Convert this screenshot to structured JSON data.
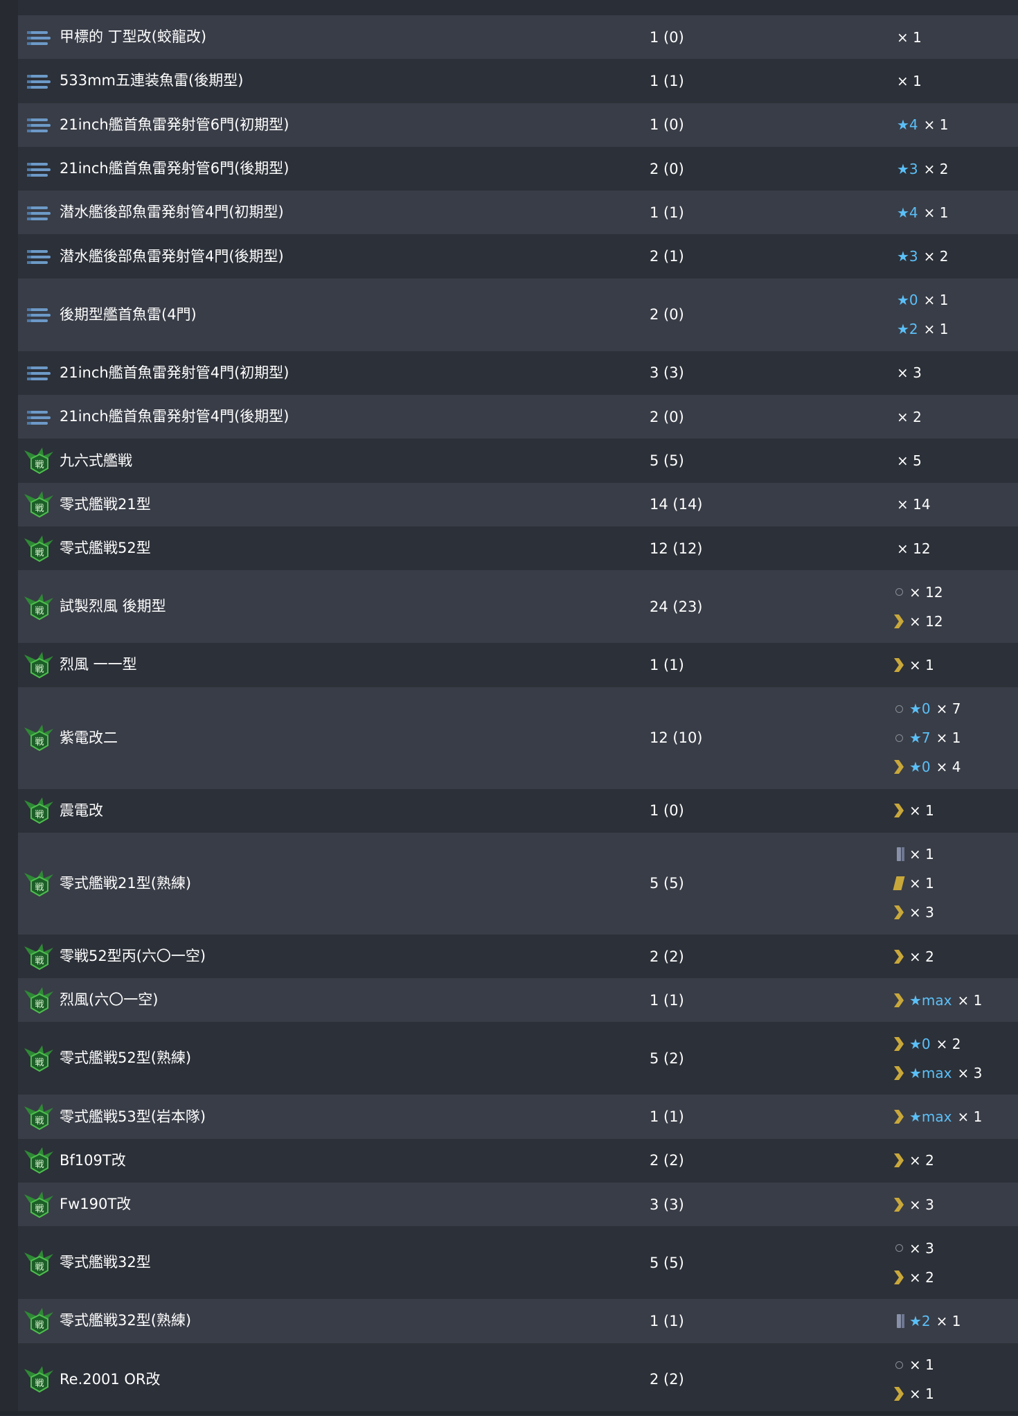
{
  "rows": [
    {
      "name": "甲標的 丁型改(蛟龍改)",
      "count": "1 (0)",
      "icon": "torpedo-icon",
      "stock": [
        {
          "slot": "none",
          "star": "",
          "qty": "× 1"
        }
      ]
    },
    {
      "name": "533mm五連装魚雷(後期型)",
      "count": "1 (1)",
      "icon": "torpedo-icon",
      "stock": [
        {
          "slot": "none",
          "star": "",
          "qty": "× 1"
        }
      ]
    },
    {
      "name": "21inch艦首魚雷発射管6門(初期型)",
      "count": "1 (0)",
      "icon": "torpedo-icon",
      "stock": [
        {
          "slot": "none",
          "star": "★4",
          "qty": "× 1"
        }
      ]
    },
    {
      "name": "21inch艦首魚雷発射管6門(後期型)",
      "count": "2 (0)",
      "icon": "torpedo-icon",
      "stock": [
        {
          "slot": "none",
          "star": "★3",
          "qty": "× 2"
        }
      ]
    },
    {
      "name": "潜水艦後部魚雷発射管4門(初期型)",
      "count": "1 (1)",
      "icon": "torpedo-icon",
      "stock": [
        {
          "slot": "none",
          "star": "★4",
          "qty": "× 1"
        }
      ]
    },
    {
      "name": "潜水艦後部魚雷発射管4門(後期型)",
      "count": "2 (1)",
      "icon": "torpedo-icon",
      "stock": [
        {
          "slot": "none",
          "star": "★3",
          "qty": "× 2"
        }
      ]
    },
    {
      "name": "後期型艦首魚雷(4門)",
      "count": "2 (0)",
      "icon": "torpedo-icon",
      "stock": [
        {
          "slot": "none",
          "star": "★0",
          "qty": "× 1"
        },
        {
          "slot": "none",
          "star": "★2",
          "qty": "× 1"
        }
      ]
    },
    {
      "name": "21inch艦首魚雷発射管4門(初期型)",
      "count": "3 (3)",
      "icon": "torpedo-icon",
      "stock": [
        {
          "slot": "none",
          "star": "",
          "qty": "× 3"
        }
      ]
    },
    {
      "name": "21inch艦首魚雷発射管4門(後期型)",
      "count": "2 (0)",
      "icon": "torpedo-icon",
      "stock": [
        {
          "slot": "none",
          "star": "",
          "qty": "× 2"
        }
      ]
    },
    {
      "name": "九六式艦戦",
      "count": "5 (5)",
      "icon": "fighter-icon",
      "stock": [
        {
          "slot": "none",
          "star": "",
          "qty": "× 5"
        }
      ]
    },
    {
      "name": "零式艦戦21型",
      "count": "14 (14)",
      "icon": "fighter-icon",
      "stock": [
        {
          "slot": "none",
          "star": "",
          "qty": "× 14"
        }
      ]
    },
    {
      "name": "零式艦戦52型",
      "count": "12 (12)",
      "icon": "fighter-icon",
      "stock": [
        {
          "slot": "none",
          "star": "",
          "qty": "× 12"
        }
      ]
    },
    {
      "name": "試製烈風 後期型",
      "count": "24 (23)",
      "icon": "fighter-icon",
      "stock": [
        {
          "slot": "circle",
          "star": "",
          "qty": "× 12"
        },
        {
          "slot": "chevron",
          "star": "",
          "qty": "× 12"
        }
      ]
    },
    {
      "name": "烈風 一一型",
      "count": "1 (1)",
      "icon": "fighter-icon",
      "stock": [
        {
          "slot": "chevron",
          "star": "",
          "qty": "× 1"
        }
      ]
    },
    {
      "name": "紫電改二",
      "count": "12 (10)",
      "icon": "fighter-icon",
      "stock": [
        {
          "slot": "circle",
          "star": "★0",
          "qty": "× 7"
        },
        {
          "slot": "circle",
          "star": "★7",
          "qty": "× 1"
        },
        {
          "slot": "chevron",
          "star": "★0",
          "qty": "× 4"
        }
      ]
    },
    {
      "name": "震電改",
      "count": "1 (0)",
      "icon": "fighter-icon",
      "stock": [
        {
          "slot": "chevron",
          "star": "",
          "qty": "× 1"
        }
      ]
    },
    {
      "name": "零式艦戦21型(熟練)",
      "count": "5 (5)",
      "icon": "fighter-icon",
      "stock": [
        {
          "slot": "bar1",
          "star": "",
          "qty": "× 1"
        },
        {
          "slot": "bar2",
          "star": "",
          "qty": "× 1"
        },
        {
          "slot": "chevron",
          "star": "",
          "qty": "× 3"
        }
      ]
    },
    {
      "name": "零戦52型丙(六〇一空)",
      "count": "2 (2)",
      "icon": "fighter-icon",
      "stock": [
        {
          "slot": "chevron",
          "star": "",
          "qty": "× 2"
        }
      ]
    },
    {
      "name": "烈風(六〇一空)",
      "count": "1 (1)",
      "icon": "fighter-icon",
      "stock": [
        {
          "slot": "chevron",
          "star": "★max",
          "qty": "× 1"
        }
      ]
    },
    {
      "name": "零式艦戦52型(熟練)",
      "count": "5 (2)",
      "icon": "fighter-icon",
      "stock": [
        {
          "slot": "chevron",
          "star": "★0",
          "qty": "× 2"
        },
        {
          "slot": "chevron",
          "star": "★max",
          "qty": "× 3"
        }
      ]
    },
    {
      "name": "零式艦戦53型(岩本隊)",
      "count": "1 (1)",
      "icon": "fighter-icon",
      "stock": [
        {
          "slot": "chevron",
          "star": "★max",
          "qty": "× 1"
        }
      ]
    },
    {
      "name": "Bf109T改",
      "count": "2 (2)",
      "icon": "fighter-icon",
      "stock": [
        {
          "slot": "chevron",
          "star": "",
          "qty": "× 2"
        }
      ]
    },
    {
      "name": "Fw190T改",
      "count": "3 (3)",
      "icon": "fighter-icon",
      "stock": [
        {
          "slot": "chevron",
          "star": "",
          "qty": "× 3"
        }
      ]
    },
    {
      "name": "零式艦戦32型",
      "count": "5 (5)",
      "icon": "fighter-icon",
      "stock": [
        {
          "slot": "circle",
          "star": "",
          "qty": "× 3"
        },
        {
          "slot": "chevron",
          "star": "",
          "qty": "× 2"
        }
      ]
    },
    {
      "name": "零式艦戦32型(熟練)",
      "count": "1 (1)",
      "icon": "fighter-icon",
      "stock": [
        {
          "slot": "bar1",
          "star": "★2",
          "qty": "× 1"
        }
      ]
    },
    {
      "name": "Re.2001 OR改",
      "count": "2 (2)",
      "icon": "fighter-icon",
      "stock": [
        {
          "slot": "circle",
          "star": "",
          "qty": "× 1"
        },
        {
          "slot": "chevron",
          "star": "",
          "qty": "× 1"
        }
      ]
    }
  ],
  "fighter_glyph": "戦",
  "colors": {
    "row_light": "#393d47",
    "row_dark": "#2c3038",
    "star_blue": "#5bc0f8",
    "chevron_gold": "#c9a83b",
    "torpedo_blue": "#6d9ac8",
    "fighter_green": "#3f9c3f"
  }
}
